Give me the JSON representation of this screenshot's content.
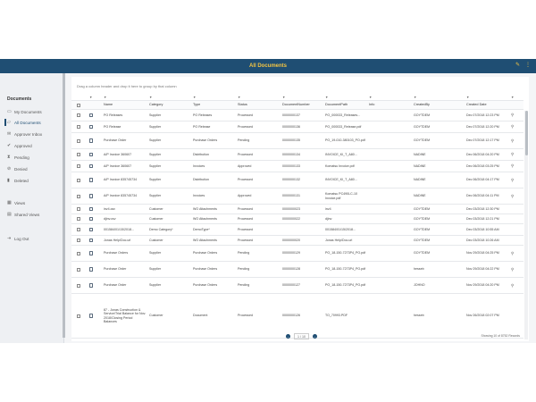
{
  "header": {
    "title": "All Documents",
    "edit_icon": "pencil-icon",
    "menu_icon": "more-vertical-icon"
  },
  "sidebar": {
    "heading": "Documents",
    "items": [
      {
        "label": "My Documents",
        "icon": "folder-icon"
      },
      {
        "label": "All Documents",
        "icon": "folder-open-icon"
      },
      {
        "label": "Approver Inbox",
        "icon": "inbox-icon"
      },
      {
        "label": "Approved",
        "icon": "check-circle-icon"
      },
      {
        "label": "Pending",
        "icon": "hourglass-icon"
      },
      {
        "label": "Denied",
        "icon": "block-icon"
      },
      {
        "label": "Deleted",
        "icon": "trash-icon"
      },
      {
        "label": "Views",
        "icon": "grid-icon"
      },
      {
        "label": "Shared Views",
        "icon": "share-icon"
      },
      {
        "label": "Log Out",
        "icon": "logout-icon"
      }
    ]
  },
  "grid": {
    "group_hint": "Drag a column header and drop it here to group by that column",
    "filter_icon": "filter-icon",
    "columns": [
      "Name",
      "Category",
      "Type",
      "Status",
      "DocumentNumber",
      "DocumentPath",
      "Info",
      "CreatedBy",
      "Created Date"
    ],
    "rows": [
      {
        "name": "PO Releases",
        "category": "Supplier",
        "type": "PO Releases",
        "status": "Processed",
        "number": "0000000137",
        "path": "PO_000033_Releases...",
        "info": "",
        "by": "GOYTDEM",
        "date": "Dec 07/2018 12:23 PM",
        "attach": true
      },
      {
        "name": "PO Release",
        "category": "Supplier",
        "type": "PO Release",
        "status": "Processed",
        "number": "0000000136",
        "path": "PO_000033_Release.pdf",
        "info": "",
        "by": "GOYTDEM",
        "date": "Dec 07/2018 12:20 PM",
        "attach": true
      },
      {
        "name": "Purchase Order",
        "category": "Supplier",
        "type": "Purchase Orders",
        "status": "Pending",
        "number": "0000000135",
        "path": "PO_19-010-380103_PO.pdf",
        "info": "",
        "by": "GOYTDEM",
        "date": "Dec 07/2018 12:17 PM",
        "attach": true
      },
      {
        "name": "A/P Invoice 360607",
        "category": "Supplier",
        "type": "Distribution",
        "status": "Processed",
        "number": "0000000134",
        "path": "INVOICE_KI_T_A80...",
        "info": "",
        "by": "NADINE",
        "date": "Dec 06/2018 04:20 PM",
        "attach": true
      },
      {
        "name": "A/P Invoice 360607",
        "category": "Supplier",
        "type": "Invoices",
        "status": "Approved",
        "number": "0000000133",
        "path": "Komatsu Invoice.pdf",
        "info": "",
        "by": "NADINE",
        "date": "Dec 06/2018 03:25 PM",
        "attach": true
      },
      {
        "name": "A/P Invoice 835745734",
        "category": "Supplier",
        "type": "Distribution",
        "status": "Processed",
        "number": "0000000132",
        "path": "INVOICE_KI_T_A80...",
        "info": "",
        "by": "NADINE",
        "date": "Dec 06/2018 04:17 PM",
        "attach": true
      },
      {
        "name": "A/P Invoice 835745734",
        "category": "Supplier",
        "type": "Invoices",
        "status": "Approved",
        "number": "0000000131",
        "path": "Komatsu PC490LC-10 Invoice.pdf",
        "info": "",
        "by": "NADINE",
        "date": "Dec 06/2018 04:11 PM",
        "attach": true
      },
      {
        "name": "inv4.csv",
        "category": "Customer",
        "type": "WO Attachments",
        "status": "Processed",
        "number": "0000000023",
        "path": "inv4",
        "info": "",
        "by": "GOYTDEM",
        "date": "Dec 03/2018 12:30 PM",
        "attach": false
      },
      {
        "name": "djinv.csv",
        "category": "Customer",
        "type": "WO Attachments",
        "status": "Processed",
        "number": "0000000022",
        "path": "djinv",
        "info": "",
        "by": "GOYTDEM",
        "date": "Dec 03/2018 12:21 PM",
        "attach": false
      },
      {
        "name": "001584/01/15/2018...",
        "category": "Demo Category*",
        "type": "DemoType*",
        "status": "Processed",
        "number": "",
        "path": "001584/01/15/2018...",
        "info": "",
        "by": "GOYTDEM",
        "date": "Dec 03/2018 10:55 AM",
        "attach": false
      },
      {
        "name": "Jonas Help/Doc.url",
        "category": "Customer",
        "type": "WO Attachments",
        "status": "Processed",
        "number": "0000000020",
        "path": "Jonas Help/Doc.url",
        "info": "",
        "by": "GOYTDEM",
        "date": "Dec 03/2018 10:26 AM",
        "attach": false
      },
      {
        "name": "Purchase Orders",
        "category": "Supplier",
        "type": "Purchase Orders",
        "status": "Pending",
        "number": "0000000129",
        "path": "PO_18-150-7273P4_PO.pdf",
        "info": "",
        "by": "GOYTDEM",
        "date": "Nov 29/2018 04:25 PM",
        "attach": true
      },
      {
        "name": "Purchase Order",
        "category": "Supplier",
        "type": "Purchase Orders",
        "status": "Pending",
        "number": "0000000128",
        "path": "PO_18-150-7273P4_PO.pdf",
        "info": "",
        "by": "hesseb",
        "date": "Nov 29/2018 04:22 PM",
        "attach": true
      },
      {
        "name": "Purchase Order",
        "category": "Supplier",
        "type": "Purchase Orders",
        "status": "Pending",
        "number": "0000000127",
        "path": "PO_18-150-7273P4_PO.pdf",
        "info": "",
        "by": "JOHNO",
        "date": "Nov 29/2018 04:20 PM",
        "attach": true
      },
      {
        "name": "87 - Jonas Construction & Service/Trial Balance for Nov. 2018/Closing Period Balances",
        "category": "Customer",
        "type": "Document",
        "status": "Processed",
        "number": "0000000126",
        "path": "TO_70993.PDF",
        "info": "",
        "by": "hesseb",
        "date": "Nov 26/2018 02:07 PM",
        "attach": false
      }
    ]
  },
  "pager": {
    "page": "1 / 10",
    "prev_icon": "chevron-left-icon",
    "next_icon": "chevron-right-icon"
  },
  "count": "Showing 10 of 8752 Records"
}
